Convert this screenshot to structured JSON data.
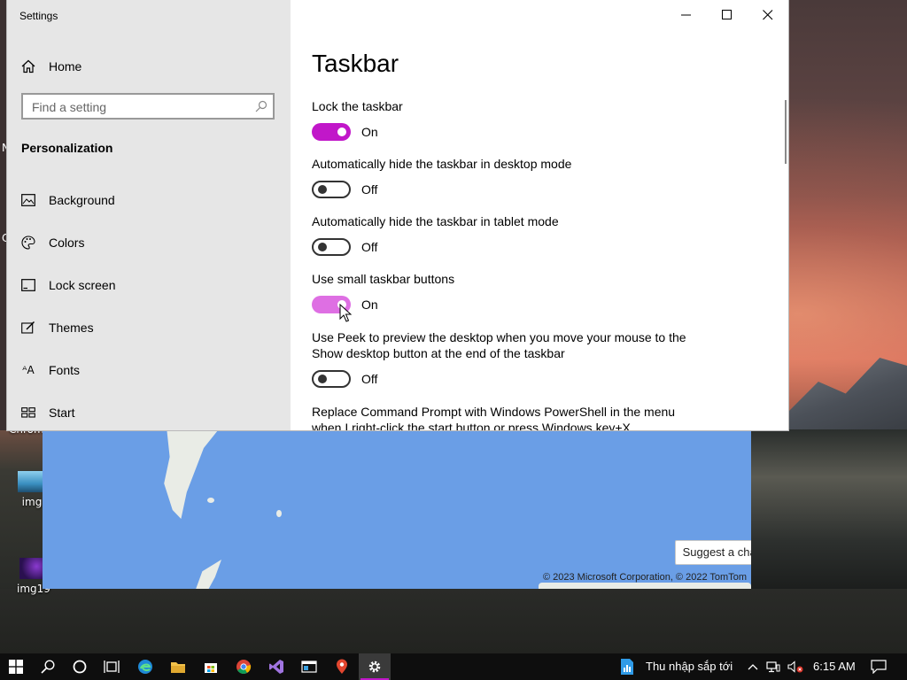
{
  "window": {
    "title": "Settings",
    "controls": {
      "minimize": "minimize",
      "maximize": "maximize",
      "close": "close"
    }
  },
  "sidebar": {
    "home": "Home",
    "search_placeholder": "Find a setting",
    "section": "Personalization",
    "items": [
      {
        "label": "Background",
        "icon": "picture-icon"
      },
      {
        "label": "Colors",
        "icon": "palette-icon"
      },
      {
        "label": "Lock screen",
        "icon": "lock-screen-icon"
      },
      {
        "label": "Themes",
        "icon": "themes-icon"
      },
      {
        "label": "Fonts",
        "icon": "fonts-icon"
      },
      {
        "label": "Start",
        "icon": "start-icon"
      }
    ]
  },
  "content": {
    "title": "Taskbar",
    "settings": [
      {
        "label": "Lock the taskbar",
        "state": "On"
      },
      {
        "label": "Automatically hide the taskbar in desktop mode",
        "state": "Off"
      },
      {
        "label": "Automatically hide the taskbar in tablet mode",
        "state": "Off"
      },
      {
        "label": "Use small taskbar buttons",
        "state": "On"
      },
      {
        "label": "Use Peek to preview the desktop when you move your mouse to the Show desktop button at the end of the taskbar",
        "state": "Off"
      },
      {
        "label": "Replace Command Prompt with Windows PowerShell in the menu when I right-click the start button or press Windows key+X"
      }
    ]
  },
  "map": {
    "suggest": "Suggest a change",
    "copyright": "© 2023 Microsoft Corporation, © 2022 TomTom"
  },
  "desktop": {
    "icons": [
      {
        "label": "img"
      },
      {
        "label": "img19"
      }
    ],
    "partial_label": "Chrom"
  },
  "taskbar": {
    "weather_text": "Thu nhập sắp tới",
    "time": "6:15 AM",
    "accent": "#c117c9"
  }
}
